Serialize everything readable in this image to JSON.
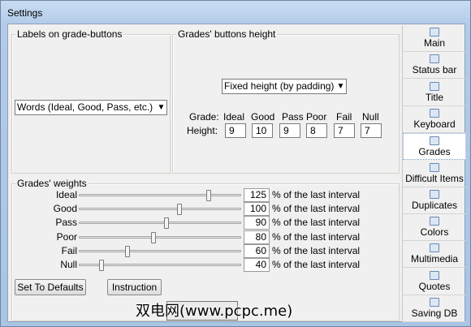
{
  "window": {
    "title": "Settings"
  },
  "labels_group": {
    "title": "Labels on grade-buttons",
    "select_value": "Words (Ideal, Good, Pass, etc.)"
  },
  "heights_group": {
    "title": "Grades' buttons height",
    "select_value": "Fixed height (by padding)",
    "grade_label": "Grade:",
    "height_label": "Height:",
    "grades": [
      {
        "name": "Ideal",
        "height": "9"
      },
      {
        "name": "Good",
        "height": "10"
      },
      {
        "name": "Pass",
        "height": "9"
      },
      {
        "name": "Poor",
        "height": "8"
      },
      {
        "name": "Fail",
        "height": "7"
      },
      {
        "name": "Null",
        "height": "7"
      }
    ]
  },
  "weights_group": {
    "title": "Grades' weights",
    "suffix": "% of the last interval",
    "rows": [
      {
        "label": "Ideal",
        "value": "125",
        "level": 0.8
      },
      {
        "label": "Good",
        "value": "100",
        "level": 0.62
      },
      {
        "label": "Pass",
        "value": "90",
        "level": 0.54
      },
      {
        "label": "Poor",
        "value": "80",
        "level": 0.46
      },
      {
        "label": "Fail",
        "value": "60",
        "level": 0.3
      },
      {
        "label": "Null",
        "value": "40",
        "level": 0.14
      }
    ]
  },
  "buttons": {
    "defaults": "Set To Defaults",
    "instruction": "Instruction"
  },
  "nav": {
    "items": [
      {
        "label": "Main",
        "icon": "main-icon"
      },
      {
        "label": "Status bar",
        "icon": "status-bar-icon"
      },
      {
        "label": "Title",
        "icon": "title-icon"
      },
      {
        "label": "Keyboard",
        "icon": "keyboard-icon"
      },
      {
        "label": "Grades",
        "icon": "grades-icon",
        "selected": true
      },
      {
        "label": "Difficult Items",
        "icon": "difficult-items-icon"
      },
      {
        "label": "Duplicates",
        "icon": "duplicates-icon"
      },
      {
        "label": "Colors",
        "icon": "colors-icon"
      },
      {
        "label": "Multimedia",
        "icon": "multimedia-icon"
      },
      {
        "label": "Quotes",
        "icon": "quotes-icon"
      },
      {
        "label": "Saving DB",
        "icon": "saving-db-icon"
      }
    ]
  },
  "watermark": "双电网(www.pcpc.me)"
}
